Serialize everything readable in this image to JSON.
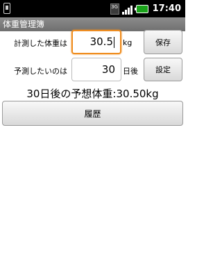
{
  "status_bar": {
    "network": "3G",
    "time": "17:40",
    "battery_color": "#1aa31a"
  },
  "app": {
    "title": "体重管理簿"
  },
  "weight_row": {
    "label": "計測した体重は",
    "value": "30.5",
    "unit": "kg",
    "button": "保存"
  },
  "days_row": {
    "label": "予測したいのは",
    "value": "30",
    "unit": "日後",
    "button": "設定"
  },
  "prediction": {
    "text": "30日後の予想体重:30.50kg"
  },
  "history_button": {
    "label": "履歴"
  },
  "colors": {
    "focus_border": "#ef8d1f",
    "title_bar": "#7d7d7d"
  }
}
